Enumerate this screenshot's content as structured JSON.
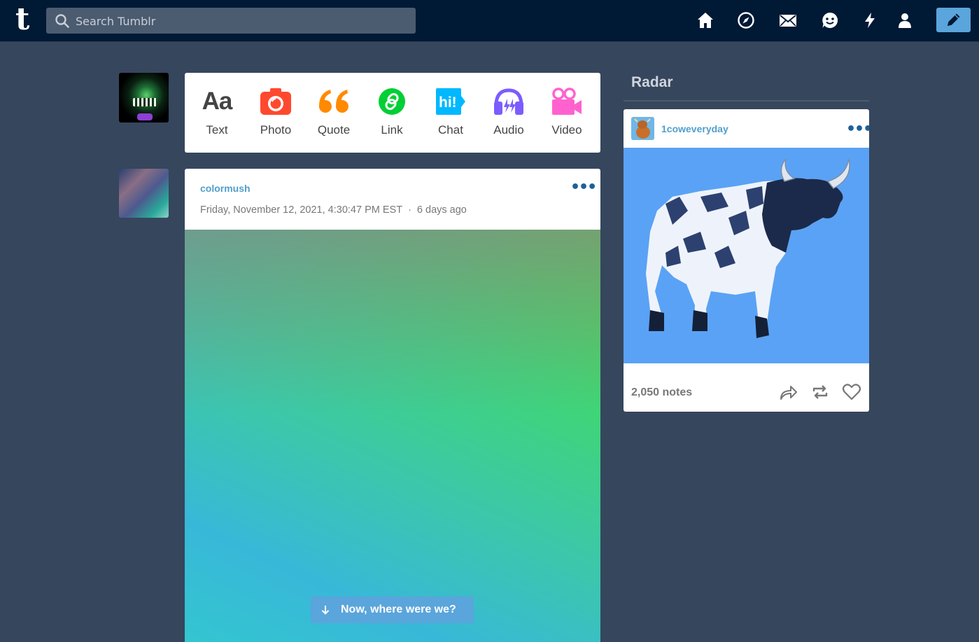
{
  "search": {
    "placeholder": "Search Tumblr"
  },
  "nav": {
    "icons": [
      "home-icon",
      "explore-icon",
      "inbox-icon",
      "messages-icon",
      "activity-icon",
      "account-icon",
      "compose-icon"
    ]
  },
  "composer": {
    "types": [
      {
        "label": "Text",
        "color": "#444444"
      },
      {
        "label": "Photo",
        "color": "#ff492f"
      },
      {
        "label": "Quote",
        "color": "#ff8a00"
      },
      {
        "label": "Link",
        "color": "#00cf35"
      },
      {
        "label": "Chat",
        "color": "#00b8ff"
      },
      {
        "label": "Audio",
        "color": "#7c5cff"
      },
      {
        "label": "Video",
        "color": "#ff62ce"
      }
    ]
  },
  "post": {
    "blog_name": "colormush",
    "date": "Friday, November 12, 2021, 4:30:47 PM EST",
    "separator": "·",
    "relative_time": "6 days ago"
  },
  "resume_pill": {
    "label": "Now, where were we?"
  },
  "radar": {
    "title": "Radar",
    "blog_name": "1coweveryday",
    "notes": "2,050 notes"
  },
  "colors": {
    "background": "#36465d",
    "topbar": "#001935",
    "accent": "#5aa5db",
    "link": "#529ecc"
  }
}
